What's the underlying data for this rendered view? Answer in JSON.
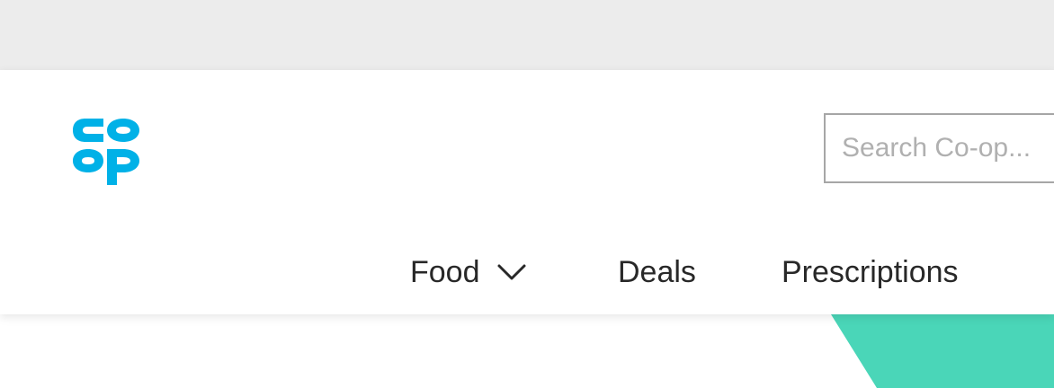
{
  "brand": {
    "name": "Co-op",
    "logo_text_top": "co",
    "logo_text_bottom": "op",
    "color": "#00b1e7"
  },
  "search": {
    "placeholder": "Search Co-op..."
  },
  "nav": {
    "items": [
      {
        "label": "Food",
        "has_dropdown": true
      },
      {
        "label": "Deals"
      },
      {
        "label": "Prescriptions"
      }
    ]
  },
  "colors": {
    "top_bar": "#ececec",
    "hero_accent": "#4ad6b8",
    "nav_text": "#282828"
  }
}
